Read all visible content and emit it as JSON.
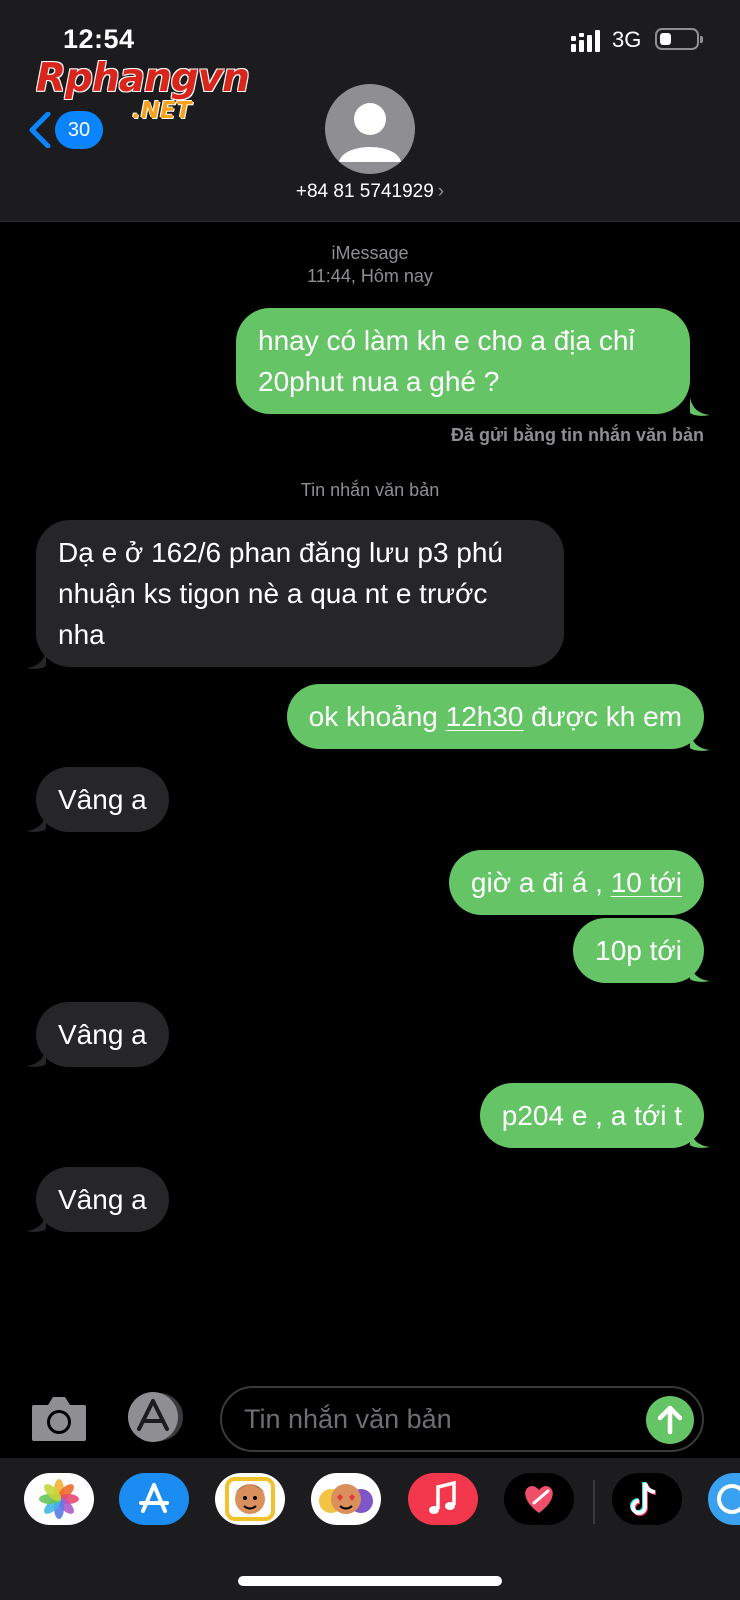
{
  "status_bar": {
    "time": "12:54",
    "network": "3G"
  },
  "watermark": {
    "main": "Rphangvn",
    "sub": ".NET"
  },
  "header": {
    "back_count": "30",
    "contact": "+84 81 5741929"
  },
  "thread": {
    "service": "iMessage",
    "timestamp": "11:44, Hôm nay",
    "sent_as_text_note": "Đã gửi bằng tin nhắn văn bản",
    "text_message_label": "Tin nhắn văn bản"
  },
  "messages": [
    {
      "direction": "out",
      "lines": [
        "hnay có làm kh e cho a địa chỉ",
        "20phut nua a ghé ?"
      ]
    },
    {
      "direction": "in",
      "lines": [
        "Dạ e ở 162/6 phan đăng lưu p3 phú",
        "nhuận ks tigon nè a qua nt e trước",
        "nha"
      ]
    },
    {
      "direction": "out",
      "before": "ok khoảng ",
      "link": "12h30",
      "after": " được kh em"
    },
    {
      "direction": "in",
      "text": "Vâng a"
    },
    {
      "direction": "out",
      "before": "giờ a đi á , ",
      "link": "10 tới",
      "after": ""
    },
    {
      "direction": "out",
      "text": "10p tới"
    },
    {
      "direction": "in",
      "text": "Vâng a"
    },
    {
      "direction": "out",
      "text": "p204 e , a tới t"
    },
    {
      "direction": "in",
      "text": "Vâng a"
    }
  ],
  "composer": {
    "placeholder": "Tin nhắn văn bản"
  },
  "app_drawer": [
    "photos-icon",
    "app-store-icon",
    "memoji-icon",
    "animoji-icon",
    "music-icon",
    "digital-touch-icon",
    "tiktok-icon",
    "extra-app-icon"
  ],
  "colors": {
    "outgoing": "#65c466",
    "incoming": "#262628",
    "accent": "#0a84ff"
  }
}
